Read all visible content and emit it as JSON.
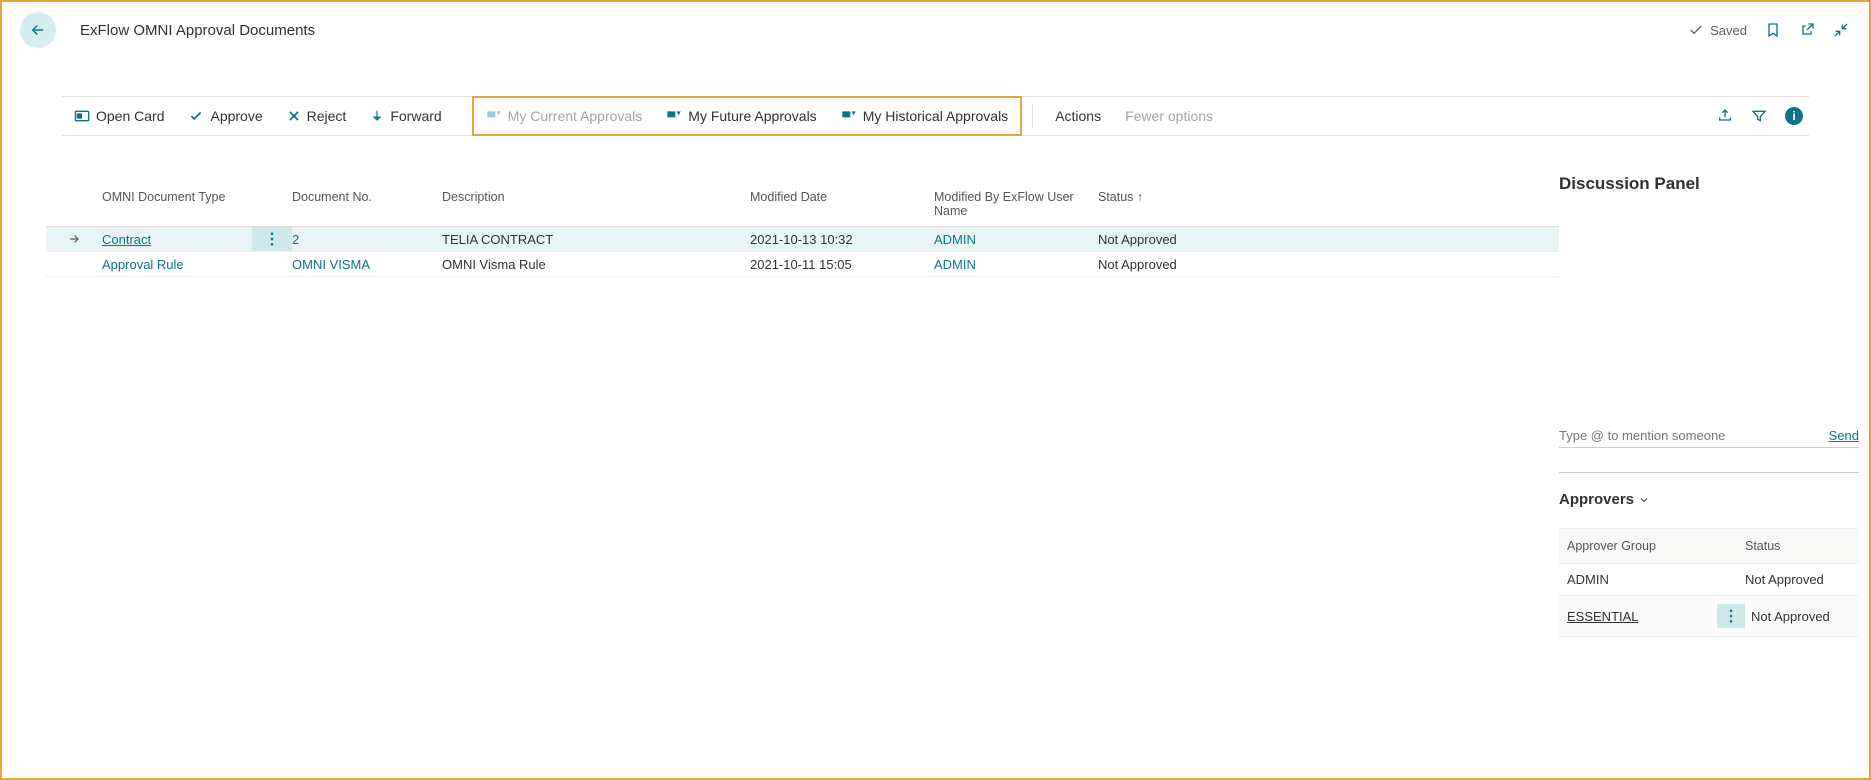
{
  "header": {
    "title": "ExFlow OMNI Approval Documents",
    "saved_label": "Saved"
  },
  "toolbar": {
    "open_card": "Open Card",
    "approve": "Approve",
    "reject": "Reject",
    "forward": "Forward",
    "my_current": "My Current Approvals",
    "my_future": "My Future Approvals",
    "my_historical": "My Historical Approvals",
    "actions": "Actions",
    "fewer_options": "Fewer options"
  },
  "table": {
    "headers": {
      "doc_type": "OMNI Document Type",
      "doc_no": "Document No.",
      "description": "Description",
      "modified_date": "Modified Date",
      "modified_by": "Modified By ExFlow User Name",
      "status": "Status ↑"
    },
    "rows": [
      {
        "selected": true,
        "doc_type": "Contract",
        "doc_no": "2",
        "description": "TELIA CONTRACT",
        "modified_date": "2021-10-13 10:32",
        "modified_by": "ADMIN",
        "status": "Not Approved"
      },
      {
        "selected": false,
        "doc_type": "Approval Rule",
        "doc_no": "OMNI VISMA",
        "description": "OMNI Visma Rule",
        "modified_date": "2021-10-11 15:05",
        "modified_by": "ADMIN",
        "status": "Not Approved"
      }
    ]
  },
  "side": {
    "discussion_title": "Discussion Panel",
    "mention_placeholder": "Type @ to mention someone",
    "send_label": "Send",
    "approvers_title": "Approvers",
    "approvers": {
      "headers": {
        "group": "Approver Group",
        "status": "Status"
      },
      "rows": [
        {
          "group": "ADMIN",
          "status": "Not Approved",
          "selected": false
        },
        {
          "group": "ESSENTIAL",
          "status": "Not Approved",
          "selected": true
        }
      ]
    }
  }
}
